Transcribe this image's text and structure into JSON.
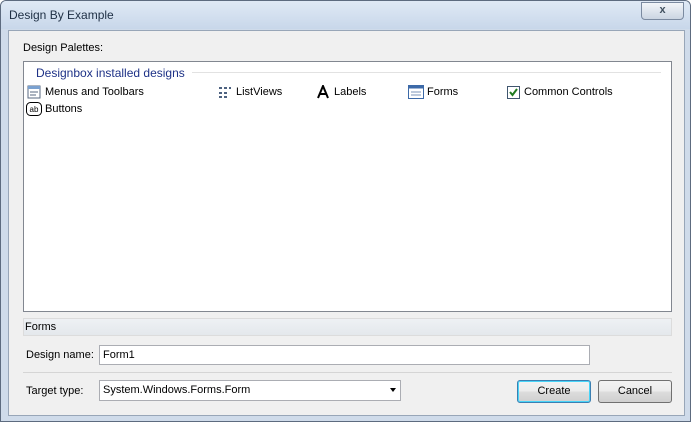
{
  "window": {
    "title": "Design By Example",
    "close_label": "x"
  },
  "palette": {
    "label": "Design Palettes:",
    "group_header": "Designbox installed designs",
    "items": [
      {
        "label": "Menus and Toolbars",
        "icon": "menu-toolbar-icon"
      },
      {
        "label": "ListViews",
        "icon": "listview-icon"
      },
      {
        "label": "Labels",
        "icon": "label-icon"
      },
      {
        "label": "Forms",
        "icon": "form-icon"
      },
      {
        "label": "Common Controls",
        "icon": "checkbox-icon"
      },
      {
        "label": "Buttons",
        "icon": "button-icon"
      }
    ]
  },
  "status": {
    "text": "Forms"
  },
  "design_name": {
    "label": "Design name:",
    "value": "Form1"
  },
  "target_type": {
    "label": "Target type:",
    "value": "System.Windows.Forms.Form"
  },
  "buttons": {
    "create": "Create",
    "cancel": "Cancel"
  }
}
